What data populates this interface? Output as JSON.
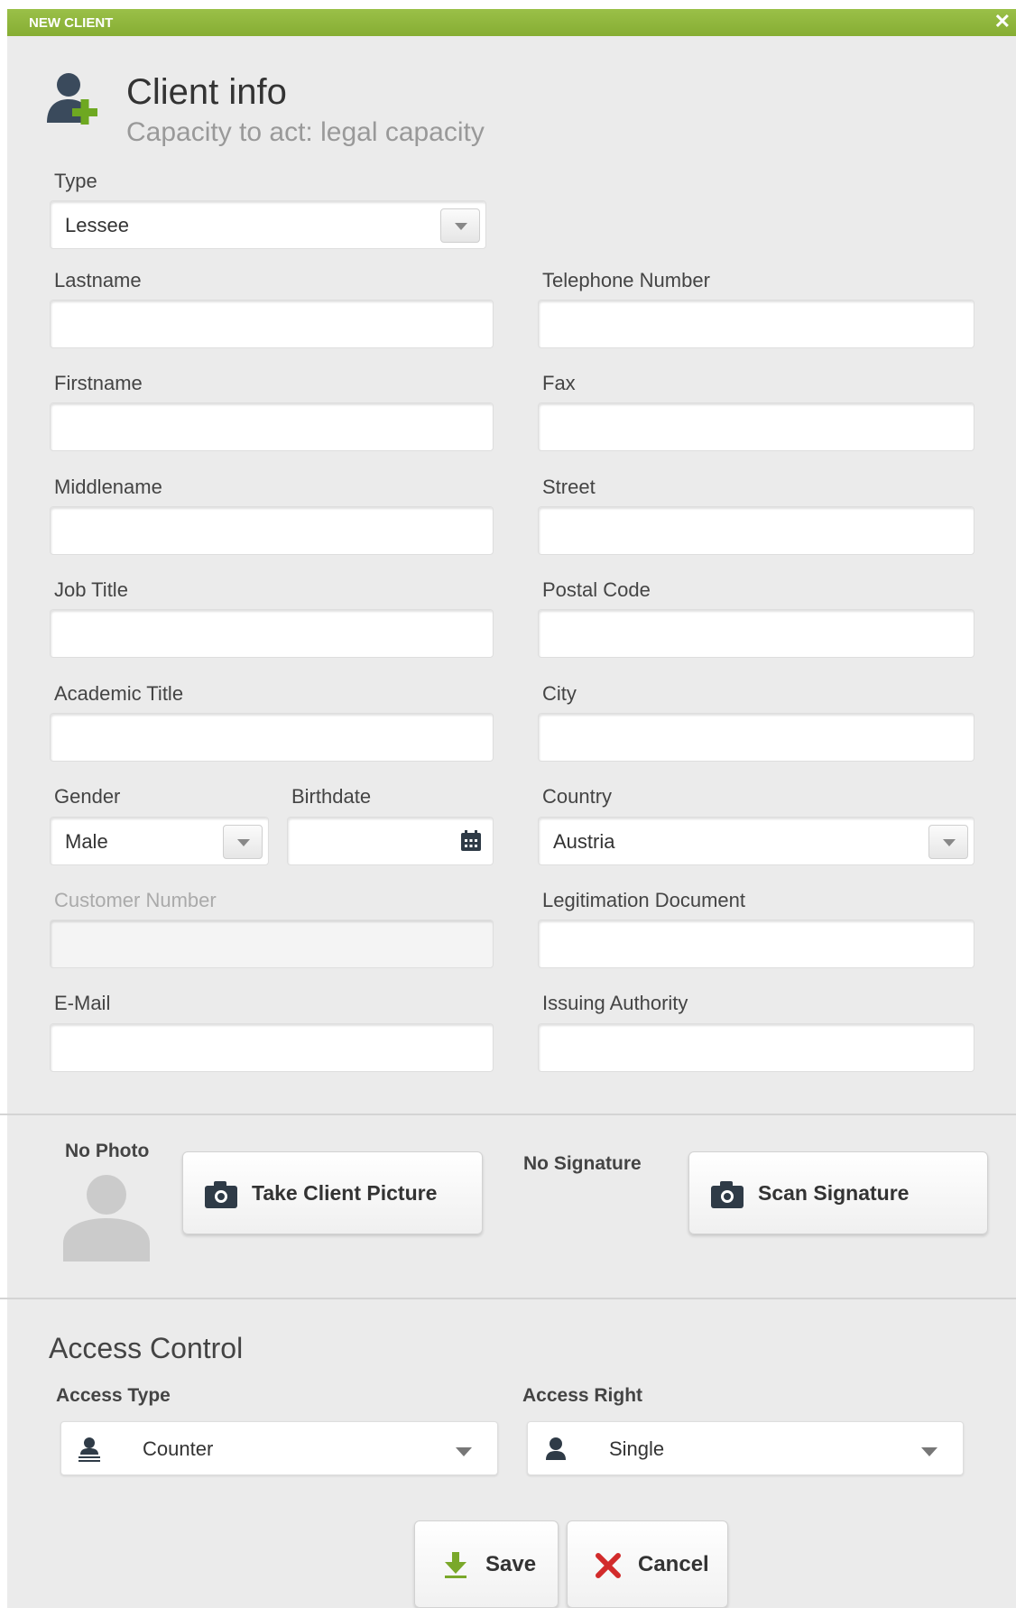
{
  "dialog": {
    "title": "NEW CLIENT",
    "close_label": "✕",
    "accent_color": "#8db63c"
  },
  "header": {
    "icon": "add-user-icon",
    "title": "Client info",
    "subtitle": "Capacity to act: legal capacity"
  },
  "form": {
    "type": {
      "label": "Type",
      "value": "Lessee"
    },
    "lastname": {
      "label": "Lastname",
      "value": ""
    },
    "firstname": {
      "label": "Firstname",
      "value": ""
    },
    "middlename": {
      "label": "Middlename",
      "value": ""
    },
    "job_title": {
      "label": "Job Title",
      "value": ""
    },
    "academic_title": {
      "label": "Academic Title",
      "value": ""
    },
    "gender": {
      "label": "Gender",
      "value": "Male"
    },
    "birthdate": {
      "label": "Birthdate",
      "value": ""
    },
    "customer_number": {
      "label": "Customer Number",
      "value": ""
    },
    "email": {
      "label": "E-Mail",
      "value": ""
    },
    "telephone": {
      "label": "Telephone Number",
      "value": ""
    },
    "fax": {
      "label": "Fax",
      "value": ""
    },
    "street": {
      "label": "Street",
      "value": ""
    },
    "postal_code": {
      "label": "Postal Code",
      "value": ""
    },
    "city": {
      "label": "City",
      "value": ""
    },
    "country": {
      "label": "Country",
      "value": "Austria"
    },
    "legitimation_document": {
      "label": "Legitimation Document",
      "value": ""
    },
    "issuing_authority": {
      "label": "Issuing Authority",
      "value": ""
    }
  },
  "media": {
    "photo_status": "No Photo",
    "take_picture_label": "Take Client Picture",
    "signature_status": "No Signature",
    "scan_signature_label": "Scan Signature"
  },
  "access": {
    "section_title": "Access Control",
    "type_label": "Access Type",
    "type_value": "Counter",
    "right_label": "Access Right",
    "right_value": "Single"
  },
  "footer": {
    "save_label": "Save",
    "cancel_label": "Cancel",
    "save_icon_color": "#7aa82a",
    "cancel_icon_color": "#d22b2b"
  }
}
